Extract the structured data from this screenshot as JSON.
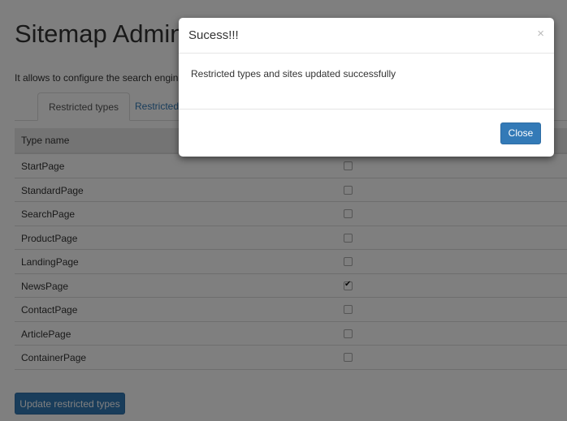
{
  "page": {
    "title": "Sitemap Admini",
    "description": "It allows to configure the search engine, i",
    "tabs": [
      "Restricted types",
      "Restricted"
    ],
    "table": {
      "header": "Type name",
      "rows": [
        {
          "name": "StartPage",
          "checked": false
        },
        {
          "name": "StandardPage",
          "checked": false
        },
        {
          "name": "SearchPage",
          "checked": false
        },
        {
          "name": "ProductPage",
          "checked": false
        },
        {
          "name": "LandingPage",
          "checked": false
        },
        {
          "name": "NewsPage",
          "checked": true
        },
        {
          "name": "ContactPage",
          "checked": false
        },
        {
          "name": "ArticlePage",
          "checked": false
        },
        {
          "name": "ContainerPage",
          "checked": false
        }
      ]
    },
    "update_button": "Update restricted types"
  },
  "modal": {
    "title": "Sucess!!!",
    "close_symbol": "×",
    "message": "Restricted types and sites updated successfully",
    "close_button": "Close"
  },
  "colors": {
    "primary": "#337ab7",
    "overlay": "rgba(0,0,0,0.5)"
  }
}
